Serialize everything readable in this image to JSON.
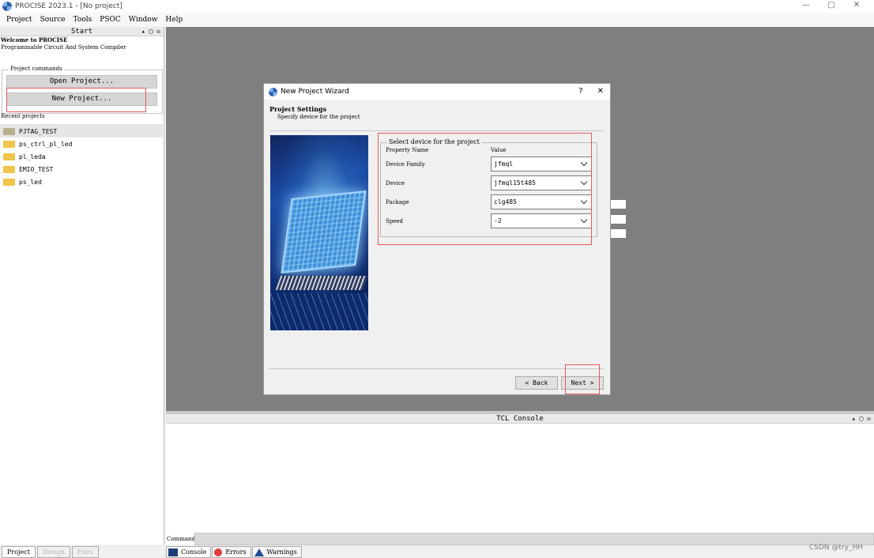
{
  "window": {
    "title": "PROCISE 2023.1 - [No project]",
    "controls": [
      "—",
      "▢",
      "✕"
    ]
  },
  "menu": [
    "Project",
    "Source",
    "Tools",
    "PSOC",
    "Window",
    "Help"
  ],
  "start_panel": {
    "title": "Start",
    "controls": "▴ ▢ ☒",
    "welcome_title": "Welcome to PROCISE",
    "welcome_subtitle": "Programmable Circuit And System Compiler",
    "commands_label": "Project commands",
    "open_project": "Open Project...",
    "new_project": "New Project...",
    "recent_label": "Recent projects",
    "recent_projects": [
      {
        "name": "PJTAG_TEST",
        "selected": true
      },
      {
        "name": "ps_ctrl_pl_led",
        "selected": false
      },
      {
        "name": "pl_leda",
        "selected": false
      },
      {
        "name": "EMIO_TEST",
        "selected": false
      },
      {
        "name": "ps_led",
        "selected": false
      }
    ]
  },
  "left_tabs": [
    {
      "label": "Project",
      "active": true
    },
    {
      "label": "Design",
      "active": false
    },
    {
      "label": "Files",
      "active": false
    }
  ],
  "dialog": {
    "title": "New Project Wizard",
    "help": "?",
    "close": "✕",
    "heading": "Project Settings",
    "subheading": "Specify device for the project",
    "group_label": "Select device for the project",
    "col_property": "Property Name",
    "col_value": "Value",
    "properties": [
      {
        "name": "Device Family",
        "value": "jfmql"
      },
      {
        "name": "Device",
        "value": "jfmql15t485"
      },
      {
        "name": "Package",
        "value": "clg485"
      },
      {
        "name": "Speed",
        "value": "-2"
      }
    ],
    "back": "< Back",
    "next": "Next >"
  },
  "tcl_console": {
    "title": "TCL Console",
    "controls": "▴ ▢ ☒",
    "command_label": "Command>",
    "command_value": ""
  },
  "console_tabs": [
    {
      "label": "Console",
      "icon": "console-icon"
    },
    {
      "label": "Errors",
      "icon": "error-icon"
    },
    {
      "label": "Warnings",
      "icon": "warning-icon"
    }
  ],
  "watermark": "CSDN @try_HH",
  "colors": {
    "workspace": "#7f7f7f",
    "highlight": "#e85a5a",
    "folder": "#f1c44b"
  }
}
